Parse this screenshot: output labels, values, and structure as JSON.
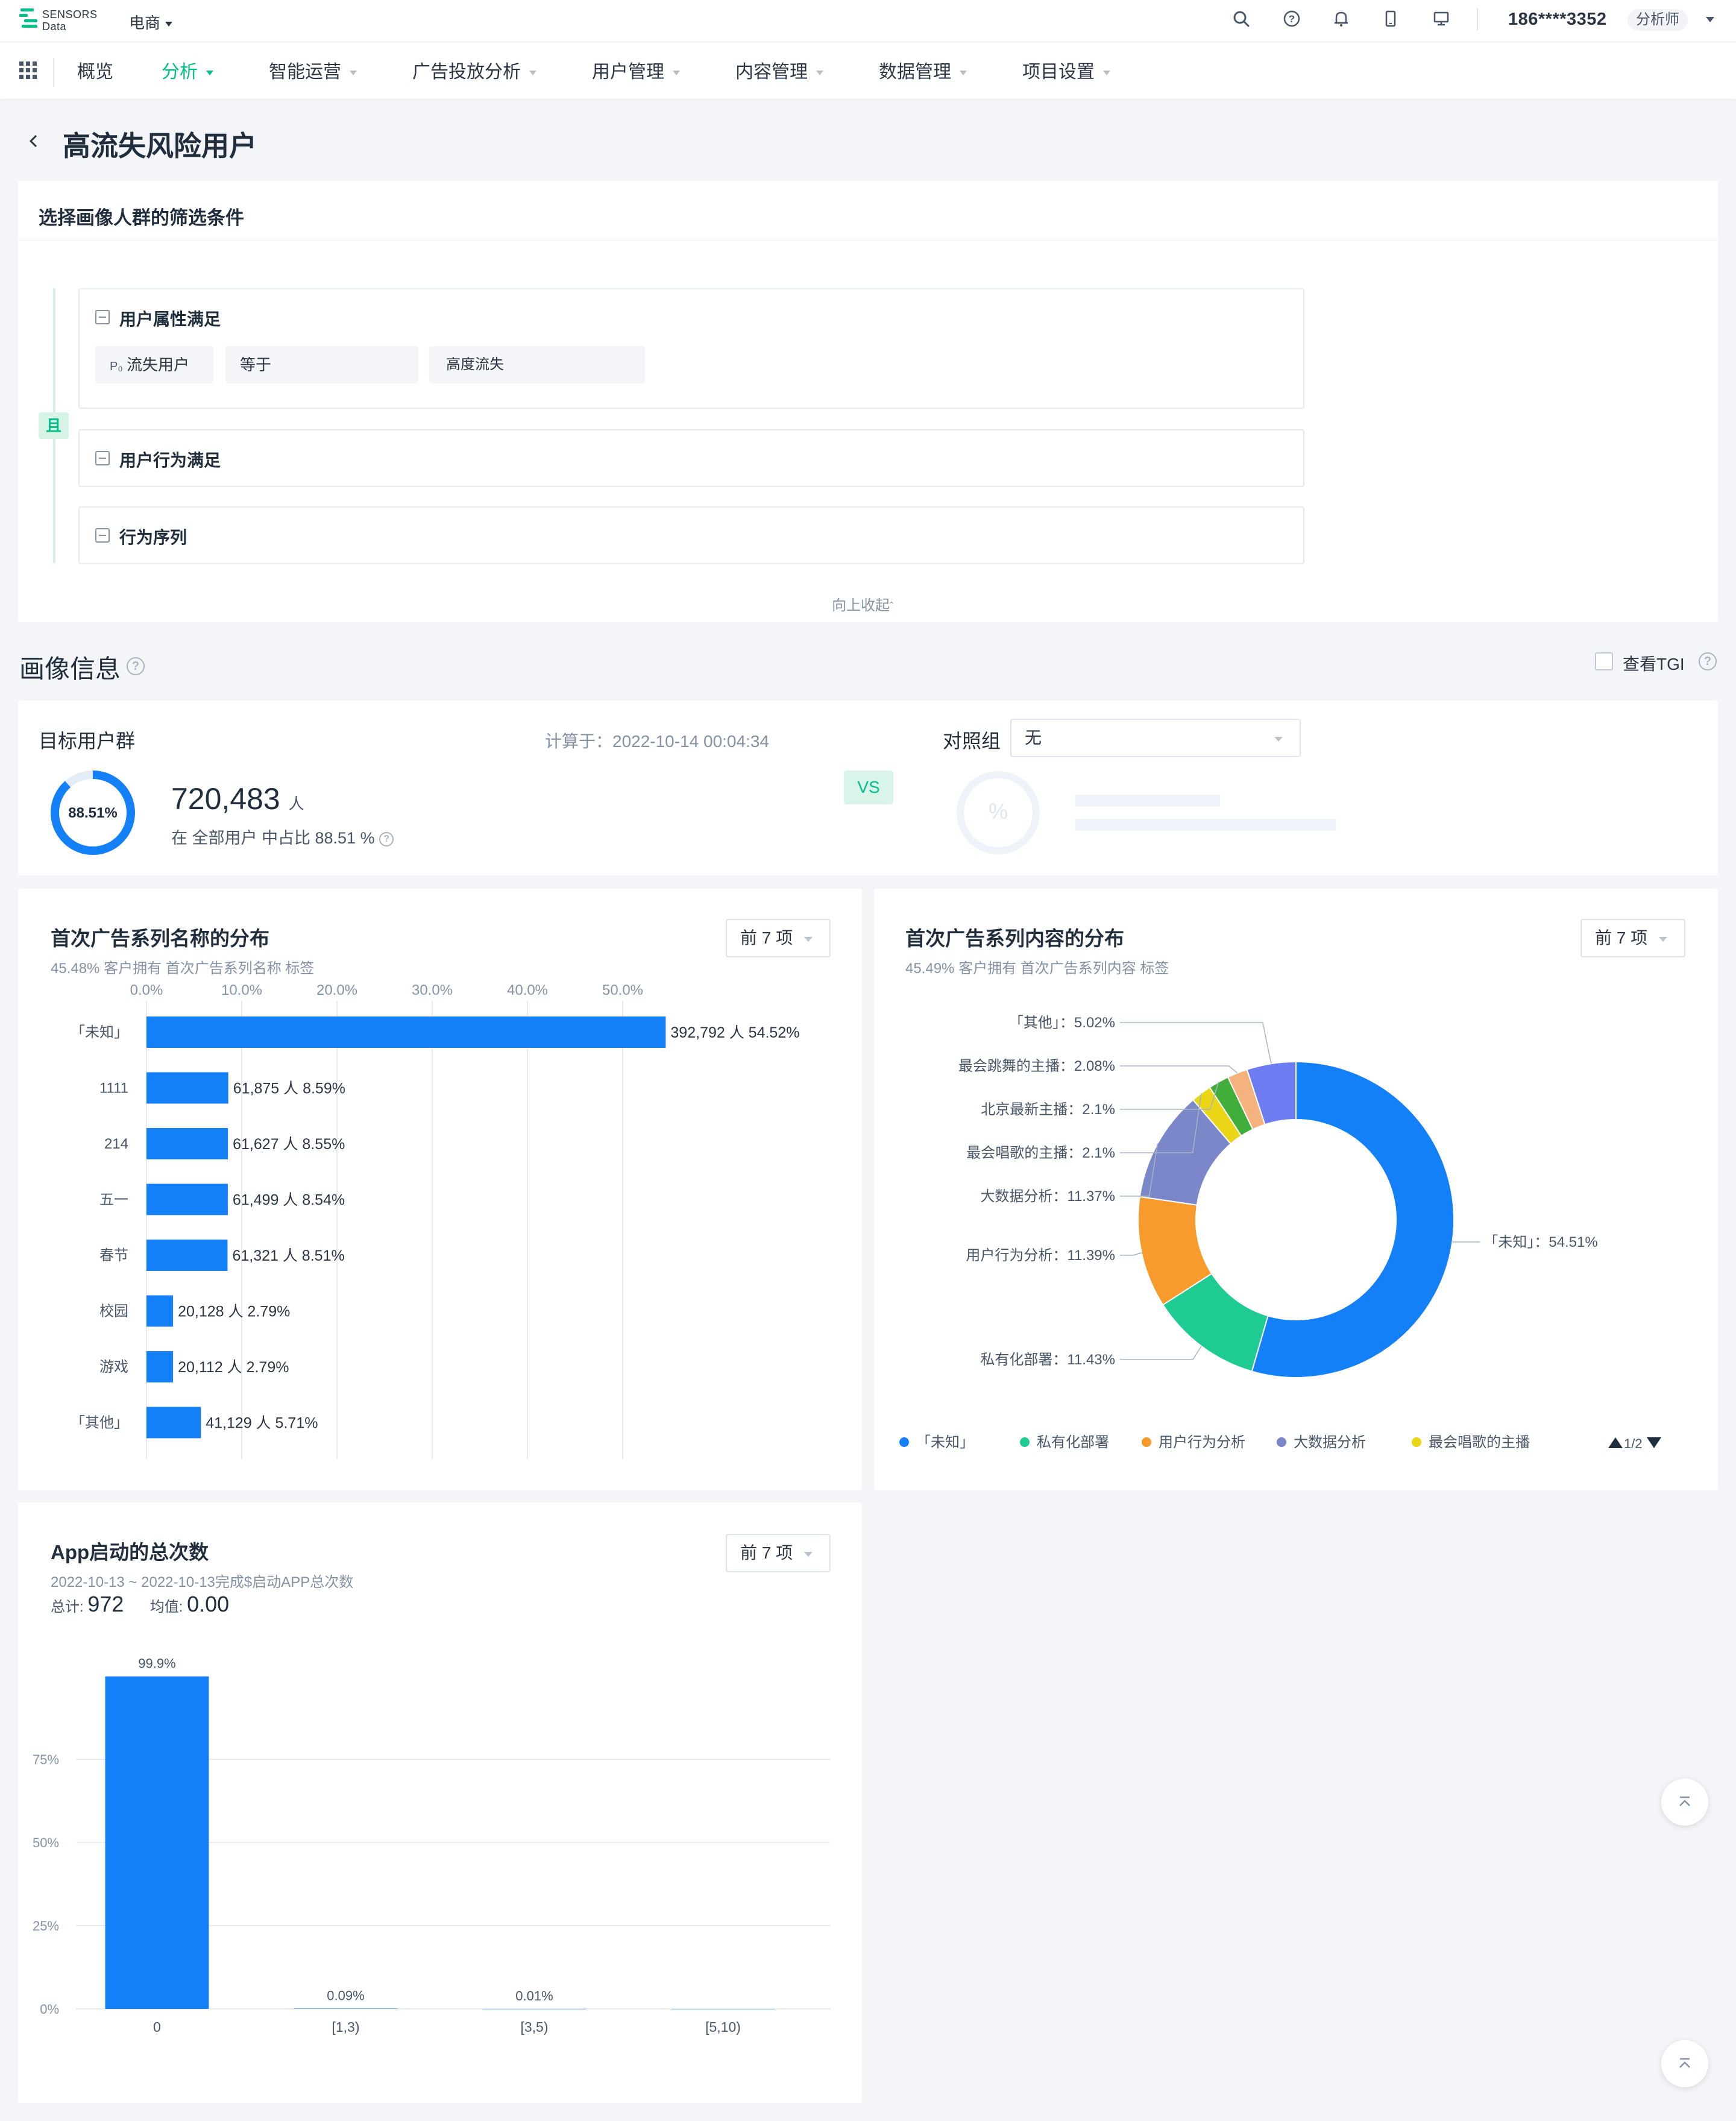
{
  "top": {
    "logo_text_1": "SENSORS",
    "logo_text_2": "Data",
    "project": "电商",
    "user_phone": "186****3352",
    "role": "分析师",
    "icons": [
      "search-icon",
      "help-icon",
      "bell-icon",
      "mobile-icon",
      "monitor-icon"
    ]
  },
  "nav": {
    "items": [
      "概览",
      "分析",
      "智能运营",
      "广告投放分析",
      "用户管理",
      "内容管理",
      "数据管理",
      "项目设置"
    ],
    "active": "分析"
  },
  "page": {
    "title": "高流失风险用户"
  },
  "filter": {
    "heading": "选择画像人群的筛选条件",
    "and_label": "且",
    "groups": {
      "attr_title": "用户属性满足",
      "behavior_title": "用户行为满足",
      "sequence_title": "行为序列"
    },
    "condition": {
      "property": "流失用户",
      "operator": "等于",
      "value": "高度流失"
    },
    "collapse": "向上收起"
  },
  "portrait": {
    "title": "画像信息",
    "tgi_label": "查看TGI"
  },
  "target": {
    "label": "目标用户群",
    "computed": "计算于：2022-10-14 00:04:34",
    "ring_pct": "88.51%",
    "ring_fraction": 0.8851,
    "count": "720,483",
    "unit": "人",
    "share": "在 全部用户 中占比 88.51 %",
    "vs": "VS",
    "compare_label": "对照组",
    "compare_value": "无",
    "compare_placeholder": "%"
  },
  "panel1": {
    "title": "首次广告系列名称的分布",
    "sub": "45.48% 客户拥有 首次广告系列名称 标签",
    "dropdown": "前 7 项"
  },
  "panel2": {
    "title": "首次广告系列内容的分布",
    "sub": "45.49% 客户拥有 首次广告系列内容 标签",
    "dropdown": "前 7 项",
    "pager": "1/2"
  },
  "panel3": {
    "title": "App启动的总次数",
    "sub": "2022-10-13 ~ 2022-10-13完成$启动APP总次数",
    "total_label": "总计:",
    "total_value": "972",
    "avg_label": "均值:",
    "avg_value": "0.00",
    "dropdown": "前 7 项"
  },
  "chart_data": [
    {
      "type": "bar",
      "orientation": "horizontal",
      "categories": [
        "「未知」",
        "1111",
        "214",
        "五一",
        "春节",
        "校园",
        "游戏",
        "「其他」"
      ],
      "values": [
        54.52,
        8.59,
        8.55,
        8.54,
        8.51,
        2.79,
        2.79,
        5.71
      ],
      "counts": [
        "392,792",
        "61,875",
        "61,627",
        "61,499",
        "61,321",
        "20,128",
        "20,112",
        "41,129"
      ],
      "labels": [
        "392,792 人 54.52%",
        "61,875 人 8.59%",
        "61,627 人 8.55%",
        "61,499 人 8.54%",
        "61,321 人 8.51%",
        "20,128 人 2.79%",
        "20,112 人 2.79%",
        "41,129 人 5.71%"
      ],
      "ticks": [
        "0.0%",
        "10.0%",
        "20.0%",
        "30.0%",
        "40.0%",
        "50.0%"
      ],
      "xlim": [
        0,
        55
      ],
      "color": "#1480f8"
    },
    {
      "type": "pie",
      "donut": true,
      "slices": [
        {
          "label": "「未知」",
          "value": 54.51,
          "text": "「未知」：54.51%",
          "color": "#1480f8"
        },
        {
          "label": "私有化部署",
          "value": 11.43,
          "text": "私有化部署：11.43%",
          "color": "#1ecb93"
        },
        {
          "label": "用户行为分析",
          "value": 11.39,
          "text": "用户行为分析：11.39%",
          "color": "#f79c2c"
        },
        {
          "label": "大数据分析",
          "value": 11.37,
          "text": "大数据分析：11.37%",
          "color": "#7b87c9"
        },
        {
          "label": "最会唱歌的主播",
          "value": 2.1,
          "text": "最会唱歌的主播：2.1%",
          "color": "#ead517"
        },
        {
          "label": "北京最新主播",
          "value": 2.1,
          "text": "北京最新主播：2.1%",
          "color": "#41ae3c"
        },
        {
          "label": "最会跳舞的主播",
          "value": 2.08,
          "text": "最会跳舞的主播：2.08%",
          "color": "#f3b27e"
        },
        {
          "label": "「其他」",
          "value": 5.02,
          "text": "「其他」：5.02%",
          "color": "#6d7cf0"
        }
      ],
      "legend": [
        "「未知」",
        "私有化部署",
        "用户行为分析",
        "大数据分析",
        "最会唱歌的主播"
      ],
      "legend_colors": [
        "#1480f8",
        "#1ecb93",
        "#f79c2c",
        "#7b87c9",
        "#ead517"
      ]
    },
    {
      "type": "bar",
      "categories": [
        "0",
        "[1,3)",
        "[3,5)",
        "[5,10)"
      ],
      "values": [
        99.9,
        0.09,
        0.01,
        0
      ],
      "value_labels": [
        "99.9%",
        "0.09%",
        "0.01%",
        ""
      ],
      "yticks": [
        "0%",
        "25%",
        "50%",
        "75%"
      ],
      "ylim": [
        0,
        100
      ],
      "color": "#1480f8"
    }
  ]
}
